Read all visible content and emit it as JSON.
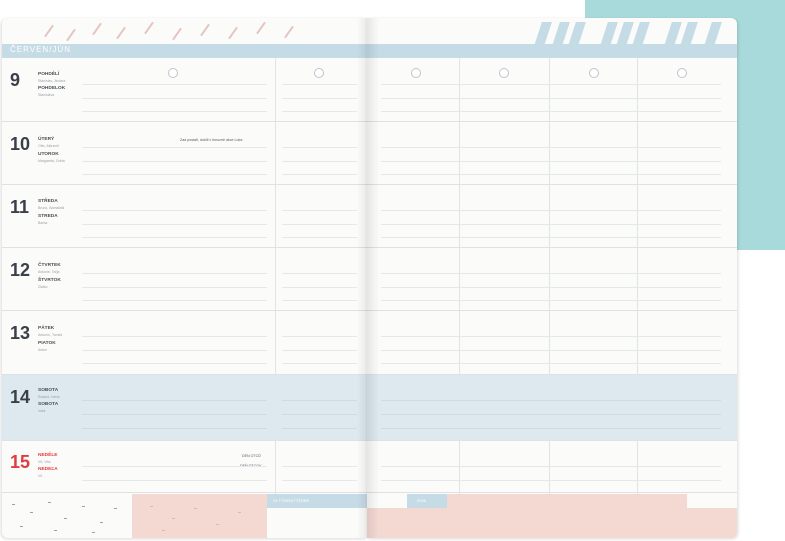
{
  "planner": {
    "month_label": "ČERVEN/JÚN",
    "days": [
      {
        "num": "9",
        "name_cz": "POHDĚLÍ",
        "sub_cz": "Stanislav, Jindara",
        "name_sk": "POHDELOK",
        "sub_sk": "Stanislava",
        "red": false
      },
      {
        "num": "10",
        "name_cz": "ÚTERÝ",
        "sub_cz": "Otto, Albrecht",
        "name_sk": "UTOROK",
        "sub_sk": "Margaréta, Gréta",
        "red": false,
        "note": "Zaa postaři, dobili v hmozně akce Loka"
      },
      {
        "num": "11",
        "name_cz": "STŘEDA",
        "sub_cz": "Bruno, Barnabáš",
        "name_sk": "STREDA",
        "sub_sk": "Barba",
        "red": false
      },
      {
        "num": "12",
        "name_cz": "ČTVRTEK",
        "sub_cz": "Antonie, Taťja",
        "name_sk": "ŠTVRTOK",
        "sub_sk": "Zlatko",
        "red": false
      },
      {
        "num": "13",
        "name_cz": "PÁTEK",
        "sub_cz": "Antonín, Tomáš",
        "name_sk": "PIATOK",
        "sub_sk": "Anton",
        "red": false
      },
      {
        "num": "14",
        "name_cz": "SOBOTA",
        "sub_cz": "Roland, Herta",
        "name_sk": "SOBOTA",
        "sub_sk": "Vasil",
        "red": false
      },
      {
        "num": "15",
        "name_cz": "NEDĚLE",
        "sub_cz": "Vít, Víta",
        "name_sk": "NEDEĽA",
        "sub_sk": "Vít",
        "red": true,
        "note1": "DEN OTCŮ",
        "note2": "DEŇ OTCOV"
      }
    ],
    "footer_left": "24  TÝDEN/TÝŽDEŇ",
    "footer_right": "2026"
  }
}
